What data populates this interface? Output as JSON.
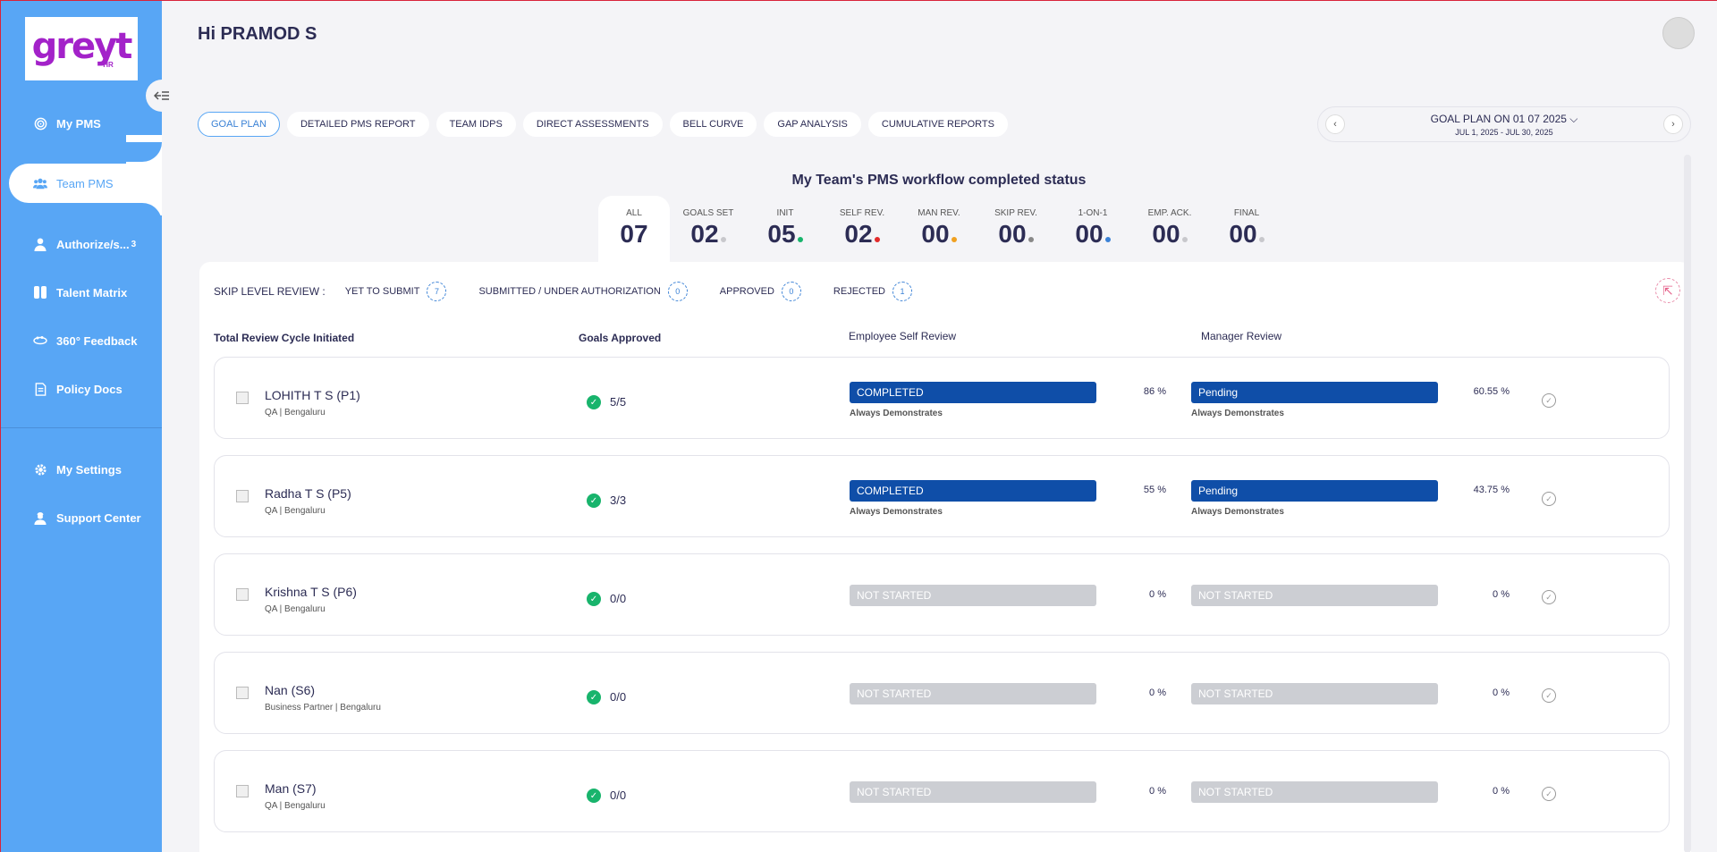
{
  "brand": {
    "logo": "greyt",
    "logo_sub": "HR",
    "accent": "#58a6f5",
    "logo_color": "#a322c9"
  },
  "sidebar": {
    "items": [
      {
        "label": "My PMS",
        "icon": "target-icon"
      },
      {
        "label": "Team PMS",
        "icon": "team-icon",
        "active": true
      },
      {
        "label": "Authorize/s...",
        "icon": "user-check-icon",
        "count": "3"
      },
      {
        "label": "Talent Matrix",
        "icon": "matrix-icon"
      },
      {
        "label": "360° Feedback",
        "icon": "feedback-icon"
      },
      {
        "label": "Policy Docs",
        "icon": "document-icon"
      }
    ],
    "bottom_items": [
      {
        "label": "My Settings",
        "icon": "gear-icon"
      },
      {
        "label": "Support Center",
        "icon": "support-icon"
      }
    ]
  },
  "header": {
    "greeting": "Hi PRAMOD S"
  },
  "tabs": [
    {
      "label": "GOAL PLAN",
      "active": true
    },
    {
      "label": "DETAILED PMS REPORT"
    },
    {
      "label": "TEAM IDPS"
    },
    {
      "label": "DIRECT ASSESSMENTS"
    },
    {
      "label": "BELL CURVE"
    },
    {
      "label": "GAP ANALYSIS"
    },
    {
      "label": "CUMULATIVE REPORTS"
    }
  ],
  "goal_plan": {
    "title": "GOAL PLAN ON 01 07 2025",
    "range": "JUL 1, 2025 - JUL 30, 2025"
  },
  "status": {
    "title": "My Team's PMS workflow completed status",
    "columns": [
      {
        "label": "ALL",
        "value": "07",
        "active": true
      },
      {
        "label": "GOALS SET",
        "value": "02",
        "dot": "#c8c8cc"
      },
      {
        "label": "INIT",
        "value": "05",
        "dot": "#18b46c"
      },
      {
        "label": "SELF REV.",
        "value": "02",
        "dot": "#e22a2a"
      },
      {
        "label": "MAN REV.",
        "value": "00",
        "dot": "#f0a020"
      },
      {
        "label": "SKIP REV.",
        "value": "00",
        "dot": "#888888"
      },
      {
        "label": "1-ON-1",
        "value": "00",
        "dot": "#3b82d6"
      },
      {
        "label": "EMP. ACK.",
        "value": "00",
        "dot": "#c8c8cc"
      },
      {
        "label": "FINAL",
        "value": "00",
        "dot": "#c8c8cc"
      }
    ]
  },
  "skip_level": {
    "label": "SKIP LEVEL REVIEW :",
    "items": [
      {
        "label": "YET TO SUBMIT",
        "count": "7"
      },
      {
        "label": "SUBMITTED / UNDER AUTHORIZATION",
        "count": "0"
      },
      {
        "label": "APPROVED",
        "count": "0"
      },
      {
        "label": "REJECTED",
        "count": "1"
      }
    ]
  },
  "table": {
    "headers": {
      "cycle": "Total Review Cycle Initiated",
      "goals": "Goals Approved",
      "self": "Employee Self Review",
      "manager": "Manager Review"
    },
    "rows": [
      {
        "name": "LOHITH T S (P1)",
        "dept": "QA | Bengaluru",
        "goals": "5/5",
        "self_status": "COMPLETED",
        "self_sub": "Always Demonstrates",
        "self_pct": "86 %",
        "man_status": "Pending",
        "man_sub": "Always Demonstrates",
        "man_pct": "60.55 %"
      },
      {
        "name": "Radha T S (P5)",
        "dept": "QA | Bengaluru",
        "goals": "3/3",
        "self_status": "COMPLETED",
        "self_sub": "Always Demonstrates",
        "self_pct": "55 %",
        "man_status": "Pending",
        "man_sub": "Always Demonstrates",
        "man_pct": "43.75 %"
      },
      {
        "name": "Krishna T S (P6)",
        "dept": "QA | Bengaluru",
        "goals": "0/0",
        "self_status": "NOT STARTED",
        "self_sub": "",
        "self_pct": "0 %",
        "man_status": "NOT STARTED",
        "man_sub": "",
        "man_pct": "0 %"
      },
      {
        "name": "Nan (S6)",
        "dept": "Business Partner | Bengaluru",
        "goals": "0/0",
        "self_status": "NOT STARTED",
        "self_sub": "",
        "self_pct": "0 %",
        "man_status": "NOT STARTED",
        "man_sub": "",
        "man_pct": "0 %"
      },
      {
        "name": "Man (S7)",
        "dept": "QA | Bengaluru",
        "goals": "0/0",
        "self_status": "NOT STARTED",
        "self_sub": "",
        "self_pct": "0 %",
        "man_status": "NOT STARTED",
        "man_sub": "",
        "man_pct": "0 %"
      }
    ]
  }
}
